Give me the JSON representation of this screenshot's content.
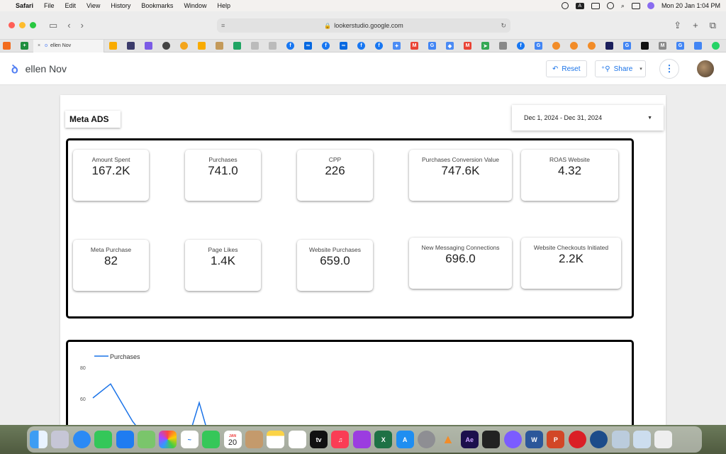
{
  "menubar": {
    "app": "Safari",
    "items": [
      "File",
      "Edit",
      "View",
      "History",
      "Bookmarks",
      "Window",
      "Help"
    ],
    "input_badge": "A",
    "datetime": "Mon 20 Jan  1:04 PM"
  },
  "browser": {
    "url": "lookerstudio.google.com",
    "active_tab": "ellen Nov"
  },
  "report": {
    "name": "ellen Nov",
    "reset_label": "Reset",
    "share_label": "Share",
    "title": "Meta ADS",
    "date_range": "Dec 1, 2024 - Dec 31, 2024"
  },
  "kpis": [
    {
      "label": "Amount Spent",
      "value": "167.2K"
    },
    {
      "label": "Purchases",
      "value": "741.0"
    },
    {
      "label": "CPP",
      "value": "226"
    },
    {
      "label": "Purchases Conversion Value",
      "value": "747.6K"
    },
    {
      "label": "ROAS Website",
      "value": "4.32"
    },
    {
      "label": "Meta Purchase",
      "value": "82"
    },
    {
      "label": "Page Likes",
      "value": "1.4K"
    },
    {
      "label": "Website Purchases",
      "value": "659.0"
    },
    {
      "label": "New Messaging Connections",
      "value": "696.0"
    },
    {
      "label": "Website Checkouts Initiated",
      "value": "2.2K"
    }
  ],
  "chart_data": {
    "type": "line",
    "series": [
      {
        "name": "Purchases",
        "color": "#1a73e8",
        "values": [
          60,
          69,
          45,
          30,
          30,
          57,
          30
        ]
      }
    ],
    "yticks": [
      "80",
      "60"
    ]
  },
  "dock": {
    "calendar_month": "JAN",
    "calendar_day": "20"
  }
}
